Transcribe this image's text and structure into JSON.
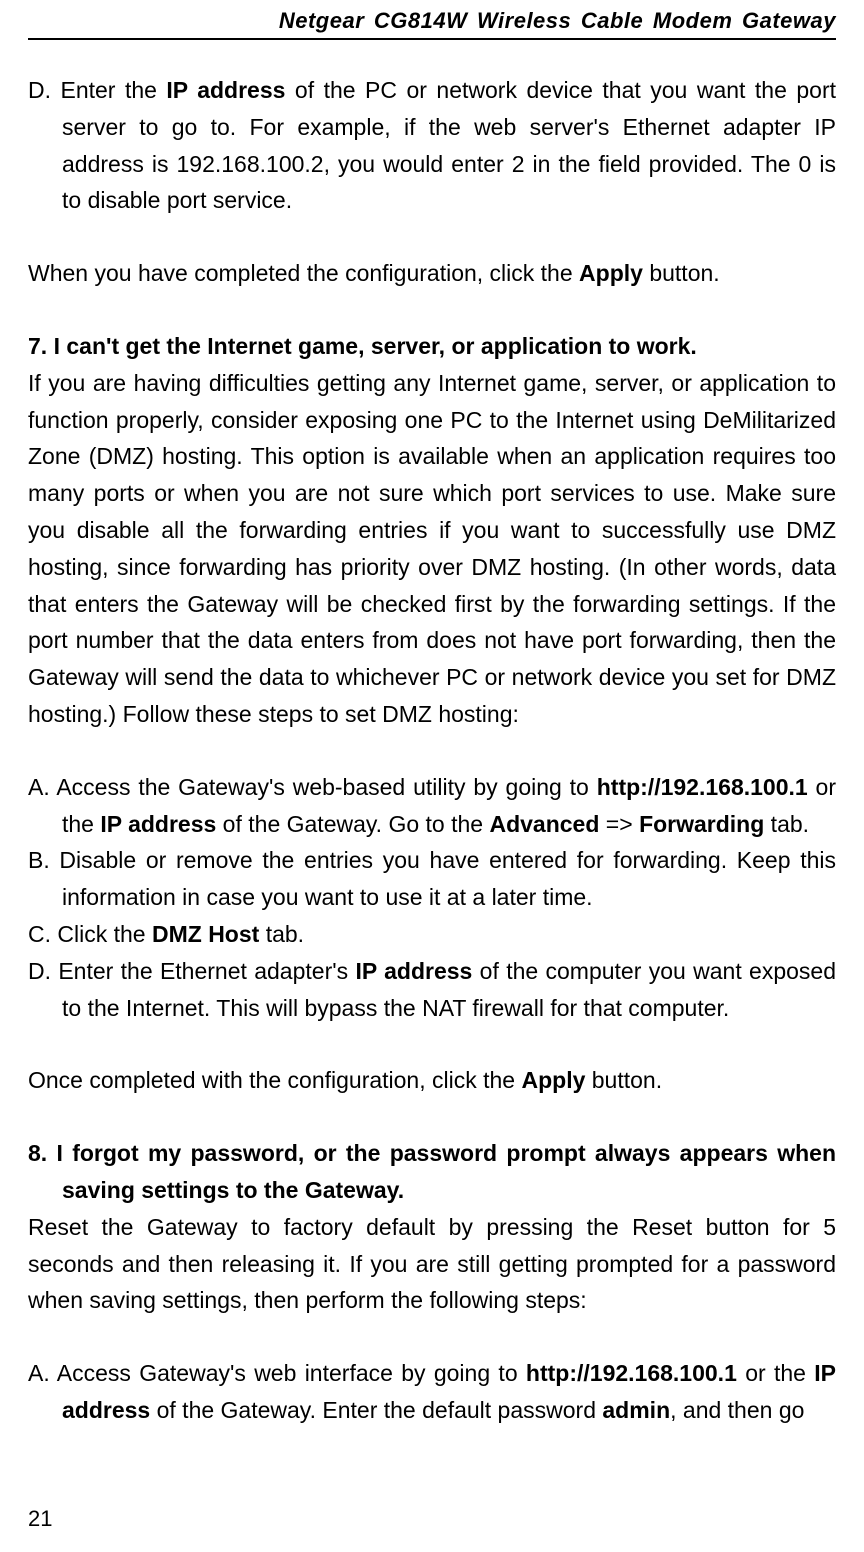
{
  "header": {
    "title": "Netgear CG814W Wireless Cable Modem Gateway"
  },
  "item_d1": {
    "marker": "D.",
    "t1": " Enter the ",
    "b1": "IP address",
    "t2": " of the PC or network device that you want the port server to go to. For example, if the web server's Ethernet adapter IP address is 192.168.100.2, you would enter 2 in the field provided. The 0 is to disable port service."
  },
  "para1": {
    "t1": "When you have completed the configuration, click the ",
    "b1": "Apply",
    "t2": " button."
  },
  "sec7": {
    "marker": "7.",
    "title": " I can't get the Internet game, server, or application to work."
  },
  "para7": "If you are having difficulties getting any Internet game, server, or application to function properly, consider exposing one PC to the Internet using DeMilitarized Zone (DMZ) hosting. This option is available when an application requires too many ports or when you are not sure which port services to use. Make sure you disable all the forwarding entries if you want to successfully use DMZ hosting, since forwarding has priority over DMZ hosting. (In other words, data that enters the Gateway will be checked first by the forwarding settings. If the port number that the data enters from does not have port forwarding, then the Gateway will send the data to whichever PC or network device you set for DMZ hosting.) Follow these steps to set DMZ hosting:",
  "item_a2": {
    "marker": "A.",
    "t1": " Access the Gateway's web-based utility by going to ",
    "b1": "http://192.168.100.1",
    "t2": " or the ",
    "b2": "IP address",
    "t3": " of the Gateway. Go to the ",
    "b3": "Advanced",
    "t4": " => ",
    "b4": "Forwarding",
    "t5": " tab."
  },
  "item_b2": {
    "marker": "B.",
    "t1": " Disable or remove the entries you have entered for forwarding. Keep this information in case you want to use it at a later time."
  },
  "item_c2": {
    "marker": "C.",
    "t1": " Click the ",
    "b1": "DMZ Host",
    "t2": " tab."
  },
  "item_d2": {
    "marker": "D.",
    "t1": " Enter the Ethernet adapter's ",
    "b1": "IP address",
    "t2": " of the computer you want exposed to the Internet. This will bypass the NAT firewall for that computer."
  },
  "para2": {
    "t1": "Once completed with the configuration, click the ",
    "b1": "Apply",
    "t2": " button."
  },
  "sec8": {
    "marker": "8.",
    "title": " I forgot my password, or the password prompt always appears when saving settings to the Gateway."
  },
  "para8": "Reset the Gateway to factory default by pressing the Reset button for 5 seconds and then releasing it. If you are still getting prompted for a password when saving settings, then perform the following steps:",
  "item_a3": {
    "marker": "A.",
    "t1": " Access Gateway's web interface by going to ",
    "b1": "http://192.168.100.1",
    "t2": " or the ",
    "b2": "IP address",
    "t3": " of the Gateway. Enter the default password ",
    "b3": "admin",
    "t4": ", and then go"
  },
  "pageNumber": "21"
}
